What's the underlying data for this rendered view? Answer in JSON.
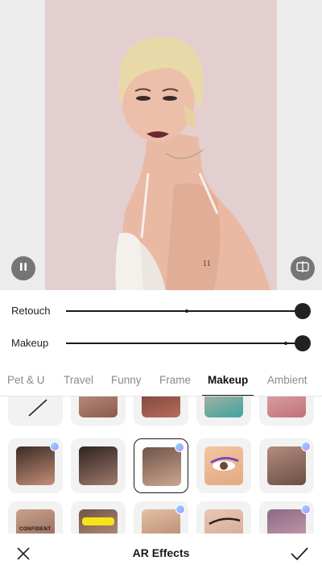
{
  "preview": {
    "pause_icon": "pause-icon",
    "compare_icon": "compare-icon"
  },
  "sliders": [
    {
      "label": "Retouch",
      "value": 1.0,
      "default": 0.51
    },
    {
      "label": "Makeup",
      "value": 1.0,
      "default": 0.93
    }
  ],
  "tabs": [
    {
      "label": "Pet & U",
      "active": false
    },
    {
      "label": "Travel",
      "active": false
    },
    {
      "label": "Funny",
      "active": false
    },
    {
      "label": "Frame",
      "active": false
    },
    {
      "label": "Makeup",
      "active": true
    },
    {
      "label": "Ambient",
      "active": false
    }
  ],
  "effects": {
    "rows": [
      [
        {
          "icon": "none-slash-icon",
          "premium": false,
          "selected": false
        },
        {
          "icon": "glitter-makeup-thumb",
          "premium": false,
          "selected": false
        },
        {
          "icon": "red-lips-thumb",
          "premium": false,
          "selected": false
        },
        {
          "icon": "eye-makeup-thumb",
          "premium": false,
          "selected": false
        },
        {
          "icon": "pink-glam-thumb",
          "premium": false,
          "selected": false
        }
      ],
      [
        {
          "icon": "classic-glam-thumb",
          "premium": true,
          "selected": false
        },
        {
          "icon": "dark-lips-thumb",
          "premium": false,
          "selected": false
        },
        {
          "icon": "natural-look-thumb",
          "premium": true,
          "selected": true
        },
        {
          "icon": "purple-liner-thumb",
          "premium": false,
          "selected": false
        },
        {
          "icon": "face-sticker-thumb",
          "premium": true,
          "selected": false
        }
      ],
      [
        {
          "icon": "confident-text-thumb",
          "premium": false,
          "selected": false
        },
        {
          "icon": "yellow-brush-thumb",
          "premium": false,
          "selected": false
        },
        {
          "icon": "soft-glam-thumb",
          "premium": true,
          "selected": false
        },
        {
          "icon": "winged-liner-thumb",
          "premium": false,
          "selected": false
        },
        {
          "icon": "bold-brow-thumb",
          "premium": true,
          "selected": false
        }
      ]
    ],
    "third_row_text": "CONFIDENT"
  },
  "bottom_bar": {
    "title": "AR Effects",
    "close_icon": "close-icon",
    "confirm_icon": "checkmark-icon"
  },
  "colors": {
    "photo_background": "#e4d0d1",
    "accent": "#1a1a1a",
    "premium_badge": "#b58cff"
  }
}
